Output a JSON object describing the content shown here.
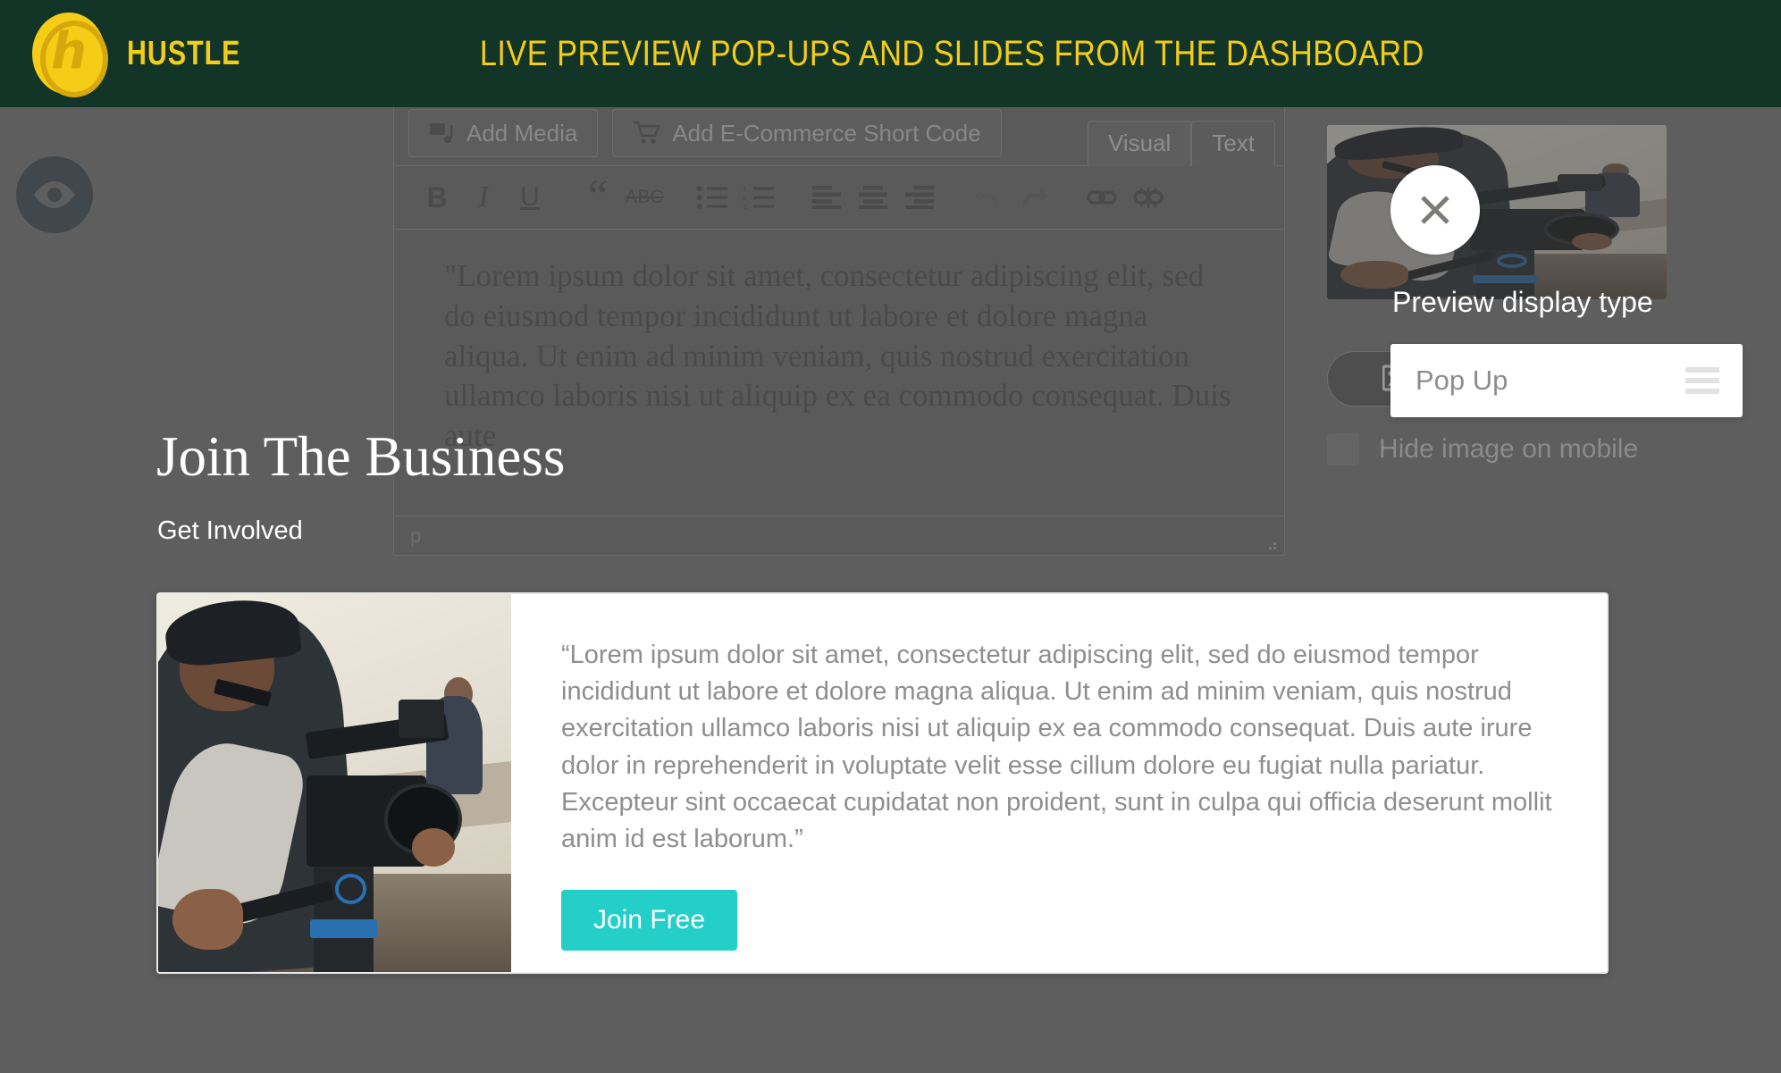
{
  "banner": {
    "brand": "HUSTLE",
    "logo_icon": "hustle-coin-logo",
    "title": "LIVE PREVIEW POP-UPS AND SLIDES FROM THE DASHBOARD",
    "background_color": "#123527",
    "accent_color": "#f5cc16"
  },
  "preview_toggle": {
    "icon": "eye-icon",
    "label": "Preview"
  },
  "editor": {
    "buttons": [
      {
        "label": "Add Media",
        "icon": "media-icon"
      },
      {
        "label": "Add E-Commerce Short Code",
        "icon": "cart-icon"
      }
    ],
    "tabs": [
      {
        "label": "Visual",
        "active": true
      },
      {
        "label": "Text",
        "active": false
      }
    ],
    "format_tools": [
      {
        "name": "bold",
        "glyph": "B"
      },
      {
        "name": "italic",
        "glyph": "I"
      },
      {
        "name": "underline",
        "glyph": "U"
      },
      {
        "name": "blockquote",
        "glyph": "“"
      },
      {
        "name": "strikethrough",
        "glyph": "ABC"
      },
      {
        "name": "bulleted-list",
        "glyph": "☰"
      },
      {
        "name": "numbered-list",
        "glyph": "☰"
      },
      {
        "name": "align-left",
        "glyph": "☰"
      },
      {
        "name": "align-center",
        "glyph": "☰"
      },
      {
        "name": "align-right",
        "glyph": "☰"
      },
      {
        "name": "undo",
        "glyph": "↶"
      },
      {
        "name": "redo",
        "glyph": "↷"
      },
      {
        "name": "insert-link",
        "glyph": "⚭"
      },
      {
        "name": "remove-link",
        "glyph": "⚮"
      }
    ],
    "content": "\"Lorem ipsum dolor sit amet, consectetur adipiscing elit, sed do eiusmod tempor incididunt ut labore et dolore magna aliqua. Ut enim ad minim veniam, quis nostrud exercitation ullamco laboris nisi ut aliquip ex ea commodo consequat. Duis aute",
    "status_path": "p",
    "resize_handle": "resize-grip-icon"
  },
  "sidebar": {
    "thumbnail_alt": "videographer-photo",
    "layout_options": [
      {
        "name": "image-left-layout",
        "active": true
      },
      {
        "name": "image-right-layout",
        "active": false
      }
    ],
    "hide_image_label": "Hide image on mobile",
    "hide_image_checked": false
  },
  "floating": {
    "close_icon": "close-icon",
    "display_type_label": "Preview display type",
    "display_type_value": "Pop Up",
    "display_type_menu_icon": "hamburger-icon"
  },
  "popup": {
    "title": "Join The Business",
    "subtitle": "Get Involved",
    "image_alt": "videographer-with-camera-photo",
    "body": "“Lorem ipsum dolor sit amet, consectetur adipiscing elit, sed do eiusmod tempor incididunt ut labore et dolore magna aliqua. Ut enim ad minim veniam, quis nostrud exercitation ullamco laboris nisi ut aliquip ex ea commodo consequat. Duis aute irure dolor in reprehenderit in voluptate velit esse cillum dolore eu fugiat nulla pariatur. Excepteur sint occaecat cupidatat non proident, sunt in culpa qui officia deserunt mollit anim id est laborum.”",
    "cta_label": "Join Free",
    "cta_color": "#23cfc8"
  }
}
